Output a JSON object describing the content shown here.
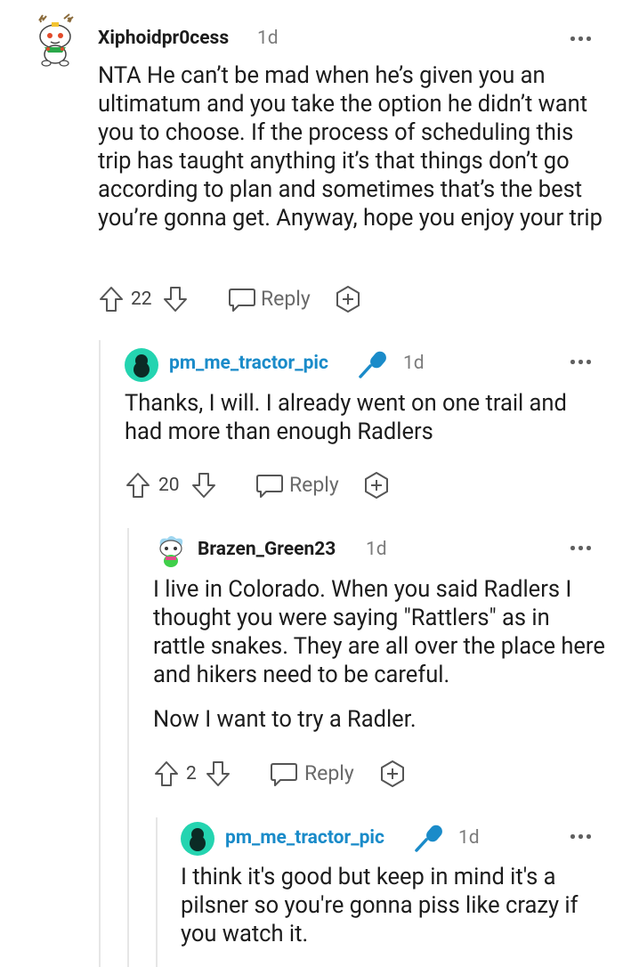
{
  "comments": [
    {
      "username": "Xiphoidpr0cess",
      "age": "1d",
      "body": "NTA He can’t be mad when he’s given you an ultimatum and you take the option he didn’t want you to choose. If the process of scheduling this trip has taught anything it’s that things don’t go according to plan and sometimes that’s the best you’re gonna get. Anyway, hope you enjoy your trip",
      "score": "22",
      "reply_label": "Reply"
    },
    {
      "username": "pm_me_tractor_pic",
      "age": "1d",
      "body": "Thanks, I will. I already went on one trail and had more than enough Radlers",
      "score": "20",
      "reply_label": "Reply"
    },
    {
      "username": "Brazen_Green23",
      "age": "1d",
      "body": "I live in Colorado. When you said Radlers I thought you were saying \"Rattlers\" as in rattle snakes. They are all over the place here and hikers need to be careful.",
      "body2": "Now I want to try a Radler.",
      "score": "2",
      "reply_label": "Reply"
    },
    {
      "username": "pm_me_tractor_pic",
      "age": "1d",
      "body": "I think it's good but keep in mind it's a pilsner so you're gonna piss like crazy if you watch it."
    }
  ],
  "icons": {
    "upvote": "upvote-arrow-icon",
    "downvote": "downvote-arrow-icon",
    "reply": "speech-bubble-icon",
    "award": "plus-award-icon",
    "more": "more-dots-icon",
    "op_badge": "microphone-icon"
  },
  "colors": {
    "op_username": "#1a8bc9",
    "avatar_teal": "#24d4b0",
    "thread_line": "#e6e6e6",
    "mic_blue": "#1a8bc9"
  }
}
